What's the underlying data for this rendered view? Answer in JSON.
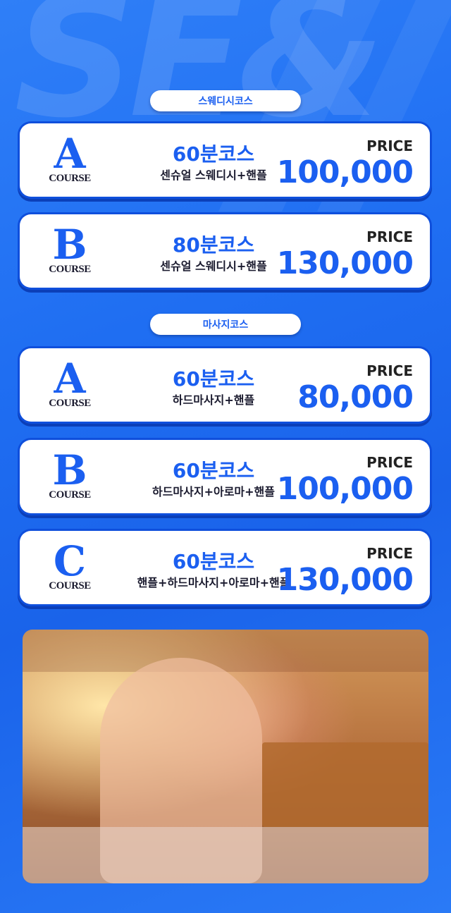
{
  "sections": {
    "swedish": {
      "title": "스웨디시코스",
      "cards": [
        {
          "letter": "A",
          "course_word": "COURSE",
          "name": "60분코스",
          "desc": "센슈얼 스웨디시+핸플",
          "price_label": "PRICE",
          "price": "100,000"
        },
        {
          "letter": "B",
          "course_word": "COURSE",
          "name": "80분코스",
          "desc": "센슈얼 스웨디시+핸플",
          "price_label": "PRICE",
          "price": "130,000"
        }
      ]
    },
    "massage": {
      "title": "마사지코스",
      "cards": [
        {
          "letter": "A",
          "course_word": "COURSE",
          "name": "60분코스",
          "desc": "하드마사지+핸플",
          "price_label": "PRICE",
          "price": "80,000"
        },
        {
          "letter": "B",
          "course_word": "COURSE",
          "name": "60분코스",
          "desc": "하드마사지+아로마+핸플",
          "price_label": "PRICE",
          "price": "100,000"
        },
        {
          "letter": "C",
          "course_word": "COURSE",
          "name": "60분코스",
          "desc": "핸플+하드마사지+아로마+핸플",
          "price_label": "PRICE",
          "price": "130,000"
        }
      ]
    }
  },
  "colors": {
    "accent": "#1b5ff0",
    "background": "#1f6ef2",
    "card": "#ffffff",
    "text_dark": "#1a1a2e"
  }
}
